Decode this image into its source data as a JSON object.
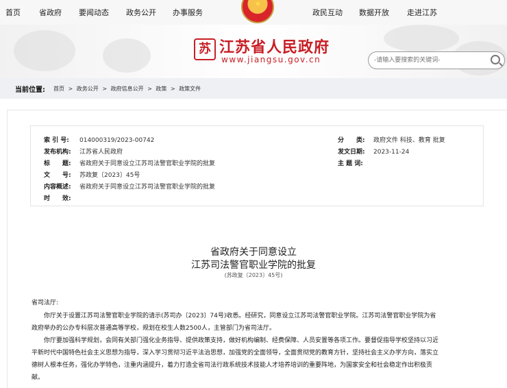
{
  "topnav": {
    "home": "首页",
    "gov": "省政府",
    "news": "要闻动态",
    "open": "政务公开",
    "service": "办事服务",
    "interact": "政民互动",
    "data": "数据开放",
    "about": "走进江苏"
  },
  "header": {
    "logo_char": "苏",
    "title": "江苏省人民政府",
    "url": "www.jiangsu.gov.cn",
    "search_placeholder": "-请输入要搜索的关键词-"
  },
  "breadcrumb": {
    "label": "当前位置:",
    "items": [
      "首页",
      ">",
      "政务公开",
      ">",
      "政府信息公开",
      ">",
      "政策",
      ">",
      "政策文件"
    ]
  },
  "meta": {
    "index_label": "索 引 号:",
    "index_value": "014000319/2023-00742",
    "org_label": "发布机构:",
    "org_value": "江苏省人民政府",
    "title_label": "标　　题:",
    "title_value": "省政府关于同意设立江苏司法警官职业学院的批复",
    "docno_label": "文　　号:",
    "docno_value": "苏政复〔2023〕45号",
    "summary_label": "内容概述:",
    "summary_value": "省政府关于同意设立江苏司法警官职业学院的批复",
    "validity_label": "时　　效:",
    "validity_value": "",
    "category_label": "分　　类:",
    "category_value": "政府文件 科技、教育 批复",
    "date_label": "发文日期:",
    "date_value": "2023-11-24",
    "subject_label": "主 题 词:",
    "subject_value": ""
  },
  "doc": {
    "title_line1": "省政府关于同意设立",
    "title_line2": "江苏司法警官职业学院的批复",
    "number": "(苏政复〔2023〕45号)",
    "addressee": "省司法厅:",
    "lines": [
      "　　你厅关于设置江苏司法警官职业学院的请示(苏司办〔2023〕74号)收悉。经研究，同意设立江苏司法警官职业学院。江苏司法警官职业学院为省",
      "政府举办的公办专科层次普通高等学校，规划在校生人数2500人，主管部门为省司法厅。",
      "　　你厅要加强科学规划，会同有关部门强化业务指导、提供政策支持，做好机构编制、经费保障、人员安置等各项工作。要督促指导学校坚持以习近",
      "平新时代中国特色社会主义思想为指导，深入学习贯彻习近平法治思想，加强党的全面领导，全面贯彻党的教育方针，坚持社会主义办学方向，落实立",
      "德树人根本任务，强化办学特色，注重内涵提升，着力打造全省司法行政系统技术技能人才培养培训的重要阵地，为国家安全和社会稳定作出积极贡",
      "献。"
    ]
  },
  "colors": {
    "brand_red": "#c81e25",
    "nav_bg": "#f7f7f7",
    "crumb_bg": "#eef0f3"
  },
  "icons": [
    "national-emblem-icon",
    "site-logo-icon",
    "search-icon"
  ]
}
